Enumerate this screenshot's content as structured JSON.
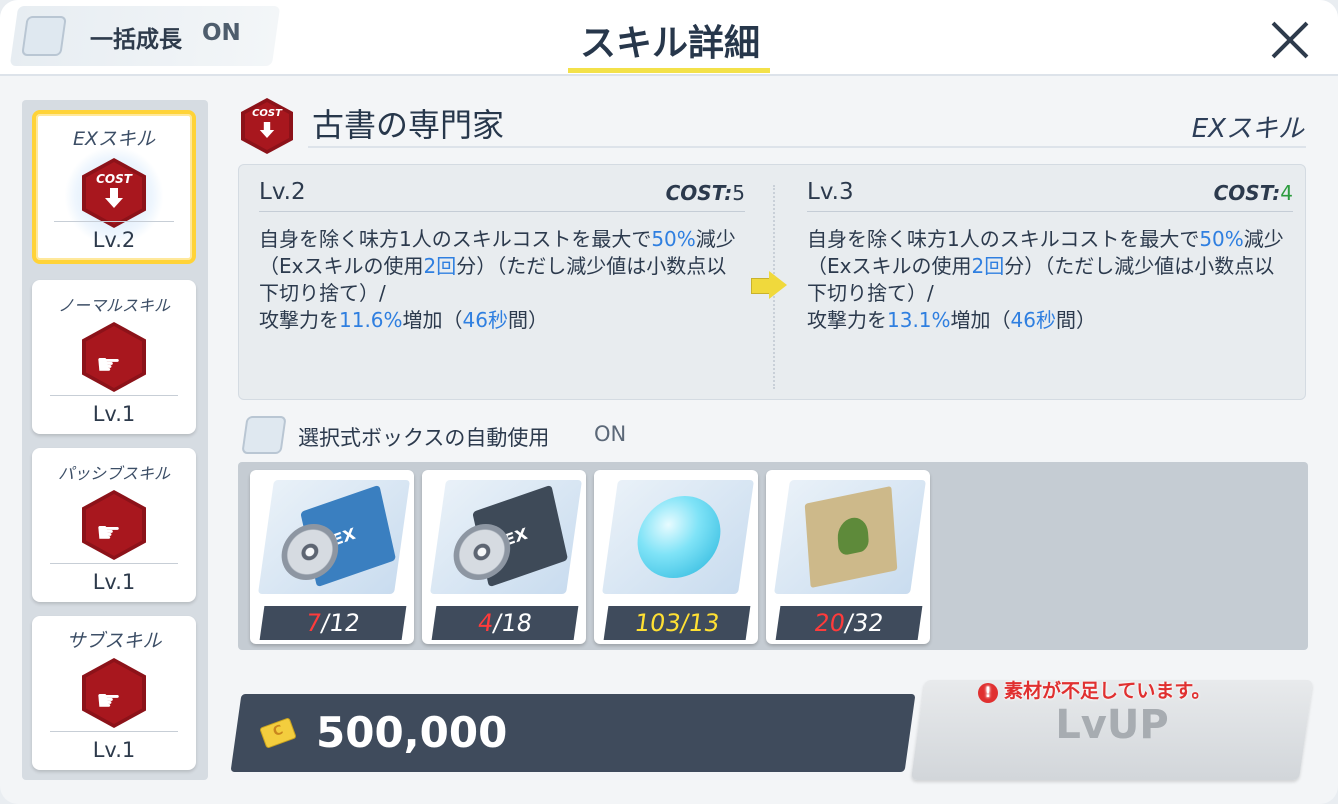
{
  "header": {
    "bulk_label": "一括成長",
    "bulk_state": "ON",
    "title": "スキル詳細"
  },
  "sidebar": {
    "cards": [
      {
        "name": "EXスキル",
        "level": "Lv.2",
        "icon": "cost-down-icon",
        "hex_text": "COST"
      },
      {
        "name": "ノーマルスキル",
        "level": "Lv.1",
        "icon": "gun-up-icon"
      },
      {
        "name": "パッシブスキル",
        "level": "Lv.1",
        "icon": "gun-up-icon"
      },
      {
        "name": "サブスキル",
        "level": "Lv.1",
        "icon": "gun-up-icon"
      }
    ]
  },
  "skill": {
    "icon_text": "COST",
    "name": "古書の専門家",
    "type": "EXスキル"
  },
  "current": {
    "level": "Lv.2",
    "cost_label": "COST:",
    "cost_value": "5",
    "desc": {
      "p1": "自身を除く味方1人のスキルコストを最大で",
      "h1": "50",
      "h2": "%",
      "p2": "減少（Exスキルの使用",
      "h3": "2回",
      "p3": "分）（ただし減少値は小数点以下切り捨て）/",
      "p4": "攻撃力を",
      "h4": "11.6%",
      "p5": "増加（",
      "h5": "46秒",
      "p6": "間）"
    }
  },
  "next": {
    "level": "Lv.3",
    "cost_label": "COST:",
    "cost_value": "4",
    "desc": {
      "p1": "自身を除く味方1人のスキルコストを最大で",
      "h1": "50",
      "h2": "%",
      "p2": "減少（Exスキルの使用",
      "h3": "2回",
      "p3": "分）（ただし減少値は小数点以下切り捨て）/",
      "p4": "攻撃力を",
      "h4": "13.1%",
      "p5": "増加（",
      "h5": "46秒",
      "p6": "間）"
    }
  },
  "auto_box": {
    "label": "選択式ボックスの自動使用",
    "state": "ON"
  },
  "materials": [
    {
      "icon": "tech-notes-disc-icon",
      "have": "7",
      "need": "/12",
      "enough": false
    },
    {
      "icon": "tech-notes-disc-gray-icon",
      "have": "4",
      "need": "/18",
      "enough": false
    },
    {
      "icon": "crystal-fragment-icon",
      "have": "103",
      "need": "/13",
      "enough": true
    },
    {
      "icon": "ancient-map-icon",
      "have": "20",
      "need": "/32",
      "enough": false
    }
  ],
  "credit": {
    "icon": "credit-icon",
    "value": "500,000"
  },
  "lvup": {
    "label": "LvUP",
    "warning": "素材が不足しています。",
    "warning_icon": "!"
  },
  "colors": {
    "highlight_blue": "#2f7fe0",
    "cost_green": "#2c9c3e",
    "insufficient_red": "#ff3b3b",
    "sufficient_yellow": "#ffe033",
    "accent_yellow": "#f3e14a",
    "skill_red": "#a8171e"
  }
}
